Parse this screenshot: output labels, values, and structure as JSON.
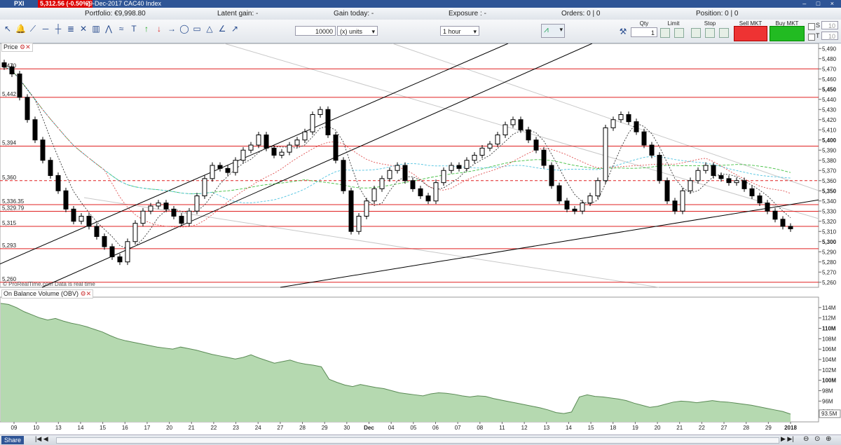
{
  "window": {
    "symbol": "PXI",
    "price_badge": "5,312.56 (-0.50%)",
    "title": "29-Dec-2017 CAC40 Index",
    "controls": "– □ ×"
  },
  "infobar": {
    "portfolio": "Portfolio: €9,998.80",
    "latent_gain": "Latent gain: -",
    "gain_today": "Gain today: -",
    "exposure": "Exposure : -",
    "orders": "Orders: 0 | 0",
    "position": "Position: 0 | 0"
  },
  "toolbar": {
    "quantity_value": "10000",
    "units_select": "(x) units",
    "timeframe_select": "1 hour",
    "qty_label": "Qty",
    "qty_value": "1",
    "limit_label": "Limit",
    "stop_label": "Stop",
    "sell_label": "Sell MKT",
    "buy_label": "Buy MKT",
    "s_label": "S",
    "s_value": "10",
    "t_label": "T",
    "t_value": "10"
  },
  "tools": [
    "cursor-icon",
    "bell-icon",
    "pen-icon",
    "hline-icon",
    "vline-icon",
    "fib-icon",
    "cross-icon",
    "bin-icon",
    "polyline-icon",
    "wave-icon",
    "text-icon",
    "arrow-up-icon",
    "arrow-down-icon",
    "arrow-right-icon",
    "ellipse-icon",
    "rectangle-icon",
    "triangle-icon",
    "angle-icon",
    "ray-icon"
  ],
  "price_panel": {
    "label": "Price",
    "watermark": "© ProRealTime.com Data is real time"
  },
  "obv_panel": {
    "label": "On Balance Volume (OBV)"
  },
  "share_label": "Share",
  "chart_data": [
    {
      "type": "candlestick",
      "title": "CAC40 Index",
      "timeframe": "1 hour",
      "ylim": [
        5255,
        5495
      ],
      "price_ticks": [
        5260,
        5270,
        5280,
        5290,
        5300,
        5310,
        5320,
        5330,
        5340,
        5350,
        5360,
        5370,
        5380,
        5390,
        5400,
        5410,
        5420,
        5430,
        5440,
        5450,
        5460,
        5470,
        5480,
        5490
      ],
      "price_tick_labels": [
        "5,260",
        "5,270",
        "5,280",
        "5,290",
        "5,300",
        "5,310",
        "5,320",
        "5,330",
        "5,340",
        "5,350",
        "5,360",
        "5,370",
        "5,380",
        "5,390",
        "5,400",
        "5,410",
        "5,420",
        "5,430",
        "5,440",
        "5,450",
        "5,460",
        "5,470",
        "5,480",
        "5,490"
      ],
      "major_ticks": [
        5300,
        5350,
        5400,
        5450
      ],
      "last_price": 5312.56,
      "x_day_labels": [
        "09",
        "10",
        "13",
        "14",
        "15",
        "16",
        "17",
        "20",
        "21",
        "22",
        "23",
        "24",
        "27",
        "28",
        "29",
        "30",
        "Dec",
        "04",
        "05",
        "06",
        "07",
        "08",
        "11",
        "12",
        "13",
        "14",
        "15",
        "18",
        "19",
        "20",
        "21",
        "22",
        "27",
        "28",
        "29",
        "2018"
      ],
      "horizontal_levels": [
        {
          "value": 5470,
          "label": "5,470"
        },
        {
          "value": 5442,
          "label": "5,442"
        },
        {
          "value": 5394,
          "label": "5,394"
        },
        {
          "value": 5360,
          "label": "5,360",
          "style": "dashed"
        },
        {
          "value": 5336.35,
          "label": "5,336.35"
        },
        {
          "value": 5329.79,
          "label": "5,329.79"
        },
        {
          "value": 5315,
          "label": "5,315"
        },
        {
          "value": 5293,
          "label": "5,293"
        },
        {
          "value": 5260,
          "label": "5,260"
        }
      ],
      "closes": [
        5472,
        5465,
        5442,
        5420,
        5400,
        5380,
        5365,
        5350,
        5332,
        5320,
        5325,
        5315,
        5305,
        5295,
        5285,
        5280,
        5300,
        5318,
        5330,
        5335,
        5338,
        5332,
        5325,
        5318,
        5330,
        5345,
        5362,
        5375,
        5372,
        5368,
        5380,
        5390,
        5395,
        5405,
        5392,
        5385,
        5388,
        5395,
        5400,
        5408,
        5425,
        5430,
        5405,
        5380,
        5350,
        5310,
        5325,
        5340,
        5352,
        5362,
        5370,
        5375,
        5360,
        5352,
        5345,
        5340,
        5358,
        5370,
        5375,
        5372,
        5380,
        5385,
        5392,
        5396,
        5405,
        5415,
        5420,
        5410,
        5400,
        5390,
        5375,
        5355,
        5340,
        5332,
        5330,
        5338,
        5345,
        5360,
        5412,
        5420,
        5425,
        5418,
        5408,
        5395,
        5385,
        5360,
        5340,
        5330,
        5350,
        5360,
        5370,
        5375,
        5365,
        5362,
        5358,
        5360,
        5352,
        5345,
        5338,
        5330,
        5322,
        5315,
        5312.56
      ]
    },
    {
      "type": "area",
      "title": "On Balance Volume (OBV)",
      "ylim": [
        92,
        116
      ],
      "tick_values": [
        94,
        96,
        98,
        100,
        102,
        104,
        106,
        108,
        110,
        112,
        114
      ],
      "tick_labels": [
        "94M",
        "96M",
        "98M",
        "100M",
        "102M",
        "104M",
        "106M",
        "108M",
        "110M",
        "112M",
        "114M"
      ],
      "major_tick_labels": [
        "110M",
        "100M"
      ],
      "last_value_label": "93.5M",
      "values": [
        114.8,
        114.6,
        114.0,
        113.2,
        112.6,
        112.0,
        111.6,
        111.9,
        111.4,
        111.0,
        110.7,
        110.3,
        109.8,
        109.3,
        108.6,
        108.0,
        107.6,
        107.3,
        107.0,
        106.7,
        106.4,
        106.2,
        106.0,
        106.4,
        106.1,
        105.8,
        105.4,
        105.0,
        104.7,
        104.4,
        104.1,
        104.4,
        104.9,
        104.3,
        103.8,
        103.3,
        103.6,
        103.9,
        103.4,
        103.1,
        102.9,
        102.6,
        100.2,
        99.6,
        99.1,
        98.8,
        99.2,
        98.9,
        98.6,
        98.4,
        98.0,
        97.6,
        97.4,
        97.2,
        97.0,
        97.4,
        97.6,
        97.5,
        97.3,
        97.0,
        96.8,
        97.0,
        96.9,
        96.5,
        96.2,
        95.9,
        95.6,
        95.3,
        95.0,
        94.7,
        94.3,
        93.8,
        93.6,
        93.9,
        96.8,
        97.2,
        96.9,
        96.8,
        96.6,
        96.4,
        96.1,
        95.6,
        95.2,
        94.8,
        95.0,
        95.4,
        95.8,
        96.0,
        95.9,
        95.7,
        95.9,
        96.1,
        95.9,
        95.8,
        95.6,
        95.4,
        95.2,
        94.9,
        94.6,
        94.3,
        94.0,
        93.5
      ],
      "fill_color": "#b5d9b0",
      "line_color": "#5a8a55"
    }
  ],
  "colors": {
    "level_line": "#e02020",
    "trendline": "#000000",
    "down_candle": "#000000",
    "up_candle": "#ffffff",
    "ma_green": "#43c043",
    "ma_cyan": "#4fc3e0",
    "ma_red": "#e05050",
    "obv_fill": "#b5d9b0"
  }
}
